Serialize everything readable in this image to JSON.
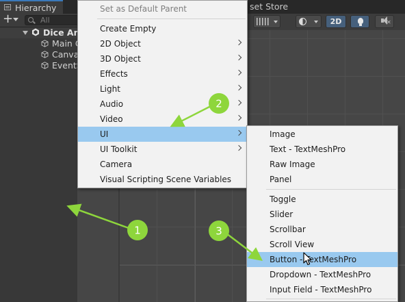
{
  "hierarchy": {
    "tab_title": "Hierarchy",
    "search_placeholder": "All",
    "root_label": "Dice Ana",
    "children": [
      "Main C",
      "Canva",
      "EventS"
    ]
  },
  "scene": {
    "asset_store_tab": "set Store",
    "toolbar": {
      "mode_2d": "2D"
    }
  },
  "main_menu": {
    "items": [
      {
        "label": "Set as Default Parent",
        "disabled": true,
        "submenu": false
      },
      {
        "label": "Create Empty",
        "disabled": false,
        "submenu": false
      },
      {
        "label": "2D Object",
        "disabled": false,
        "submenu": true
      },
      {
        "label": "3D Object",
        "disabled": false,
        "submenu": true
      },
      {
        "label": "Effects",
        "disabled": false,
        "submenu": true
      },
      {
        "label": "Light",
        "disabled": false,
        "submenu": true
      },
      {
        "label": "Audio",
        "disabled": false,
        "submenu": true
      },
      {
        "label": "Video",
        "disabled": false,
        "submenu": true
      },
      {
        "label": "UI",
        "disabled": false,
        "submenu": true,
        "highlighted": true
      },
      {
        "label": "UI Toolkit",
        "disabled": false,
        "submenu": true
      },
      {
        "label": "Camera",
        "disabled": false,
        "submenu": false
      },
      {
        "label": "Visual Scripting Scene Variables",
        "disabled": false,
        "submenu": false
      }
    ]
  },
  "ui_submenu": {
    "items": [
      {
        "label": "Image"
      },
      {
        "label": "Text - TextMeshPro"
      },
      {
        "label": "Raw Image"
      },
      {
        "label": "Panel"
      },
      {
        "label": "Toggle"
      },
      {
        "label": "Slider"
      },
      {
        "label": "Scrollbar"
      },
      {
        "label": "Scroll View"
      },
      {
        "label": "Button - TextMeshPro",
        "highlighted": true
      },
      {
        "label": "Dropdown - TextMeshPro"
      },
      {
        "label": "Input Field - TextMeshPro"
      }
    ]
  },
  "annotations": {
    "color": "#8ed63c",
    "badges": [
      "1",
      "2",
      "3"
    ]
  },
  "colors": {
    "menu_background": "#f2f2f2",
    "menu_highlight": "#99c9ef",
    "editor_dark": "#383838",
    "tab_accent": "#3a79bb"
  }
}
